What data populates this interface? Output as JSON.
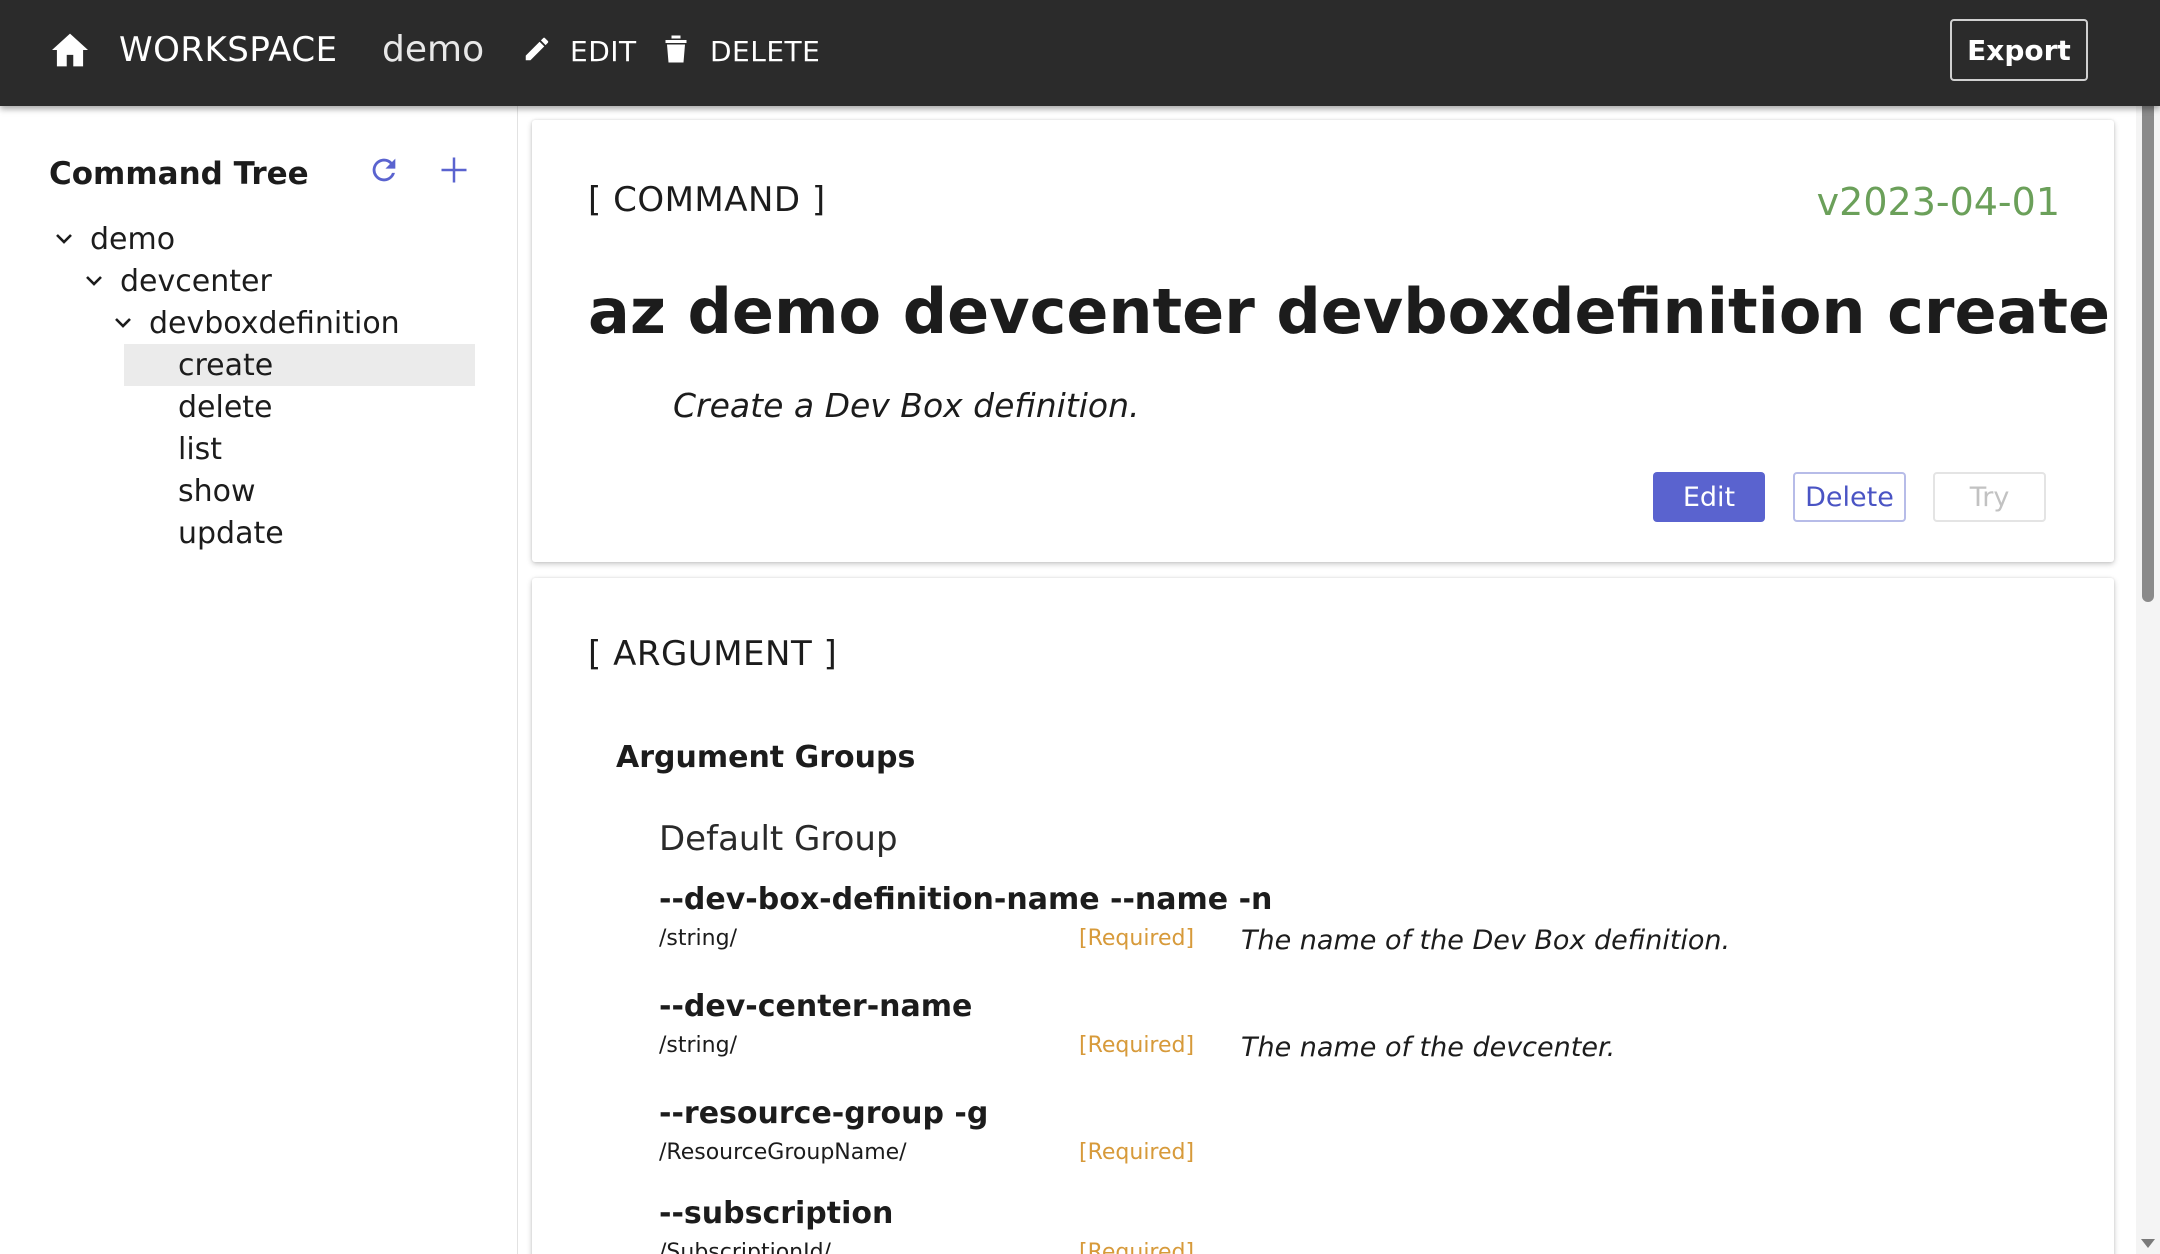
{
  "topbar": {
    "home_icon": "home-icon",
    "workspace_label": "WORKSPACE",
    "workspace_name": "demo",
    "edit_label": "EDIT",
    "delete_label": "DELETE",
    "export_label": "Export",
    "background_color": "#2b2b2b"
  },
  "sidebar": {
    "title": "Command Tree",
    "refresh_icon": "refresh-icon",
    "add_icon": "add-icon",
    "tree": {
      "root": "demo",
      "group": "devcenter",
      "subgroup": "devboxdefinition",
      "commands": [
        "create",
        "delete",
        "list",
        "show",
        "update"
      ],
      "selected": "create"
    }
  },
  "command": {
    "section_label": "[ COMMAND ]",
    "version": "v2023-04-01",
    "name": "az demo devcenter devboxdefinition create",
    "description": "Create a Dev Box definition.",
    "buttons": {
      "edit": "Edit",
      "delete": "Delete",
      "try": "Try"
    }
  },
  "argument": {
    "section_label": "[ ARGUMENT ]",
    "groups_title": "Argument Groups",
    "group": {
      "title": "Default Group",
      "args": [
        {
          "name": "--dev-box-definition-name --name -n",
          "type": "/string/",
          "required": "[Required]",
          "description": "The name of the Dev Box definition."
        },
        {
          "name": "--dev-center-name",
          "type": "/string/",
          "required": "[Required]",
          "description": "The name of the devcenter."
        },
        {
          "name": "--resource-group -g",
          "type": "/ResourceGroupName/",
          "required": "[Required]",
          "description": ""
        },
        {
          "name": "--subscription",
          "type": "/SubscriptionId/",
          "required": "[Required]",
          "description": ""
        }
      ]
    }
  },
  "colors": {
    "accent": "#5a63cf",
    "version": "#6ba05a",
    "required": "#d79a3a",
    "selected_row": "#ebebeb"
  }
}
